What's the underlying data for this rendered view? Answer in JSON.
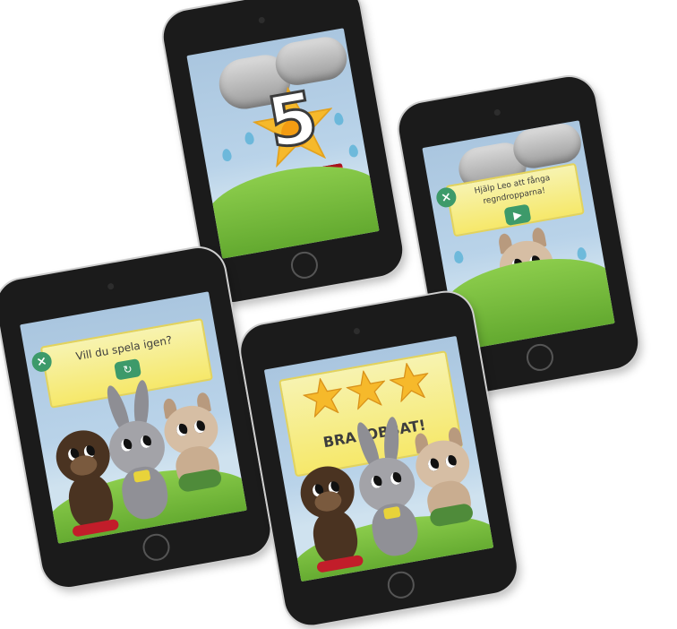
{
  "tablet_countdown": {
    "counter": "5"
  },
  "tablet_info": {
    "close_icon": "×",
    "message": "Hjälp Leo att fånga regndropparna!",
    "play_icon": "▶"
  },
  "tablet_again": {
    "close_icon": "×",
    "question": "Vill du spela igen?",
    "replay_icon": "↻"
  },
  "tablet_success": {
    "message": "BRA JOBBAT!",
    "stars": 3
  },
  "colors": {
    "banner": "#f6e86a",
    "button": "#3d9a6a",
    "sky": "#b9d3e9",
    "grass": "#6fb83a"
  }
}
